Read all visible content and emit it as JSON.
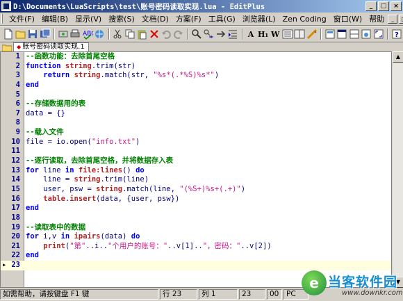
{
  "window": {
    "title": "D:\\Documents\\LuaScripts\\test\\账号密码读取实现.lua - EditPlus",
    "controls": [
      "_",
      "□",
      "×"
    ]
  },
  "menubar": {
    "items": [
      "文件(F)",
      "编辑(B)",
      "显示(V)",
      "搜索(S)",
      "文档(D)",
      "方案(F)",
      "工具(G)",
      "浏览器(L)",
      "Zen Coding",
      "窗口(W)",
      "帮助"
    ],
    "right_controls": [
      "_",
      "□",
      "×"
    ]
  },
  "toolbar": {
    "text_buttons": [
      "A",
      "H₁",
      "W"
    ],
    "icons": [
      "new-file-icon",
      "open-folder-icon",
      "save-icon",
      "save-all-icon",
      "ftp-icon",
      "print-icon",
      "spellcheck-icon",
      "preview-icon",
      "cut-icon",
      "copy-icon",
      "paste-icon",
      "clear-icon",
      "undo-icon",
      "redo-icon",
      "find-icon",
      "replace-icon",
      "goto-icon",
      "indent-icon",
      "font-icon",
      "hex-icon",
      "word-wrap-icon",
      "line-number-icon",
      "column-icon",
      "ruler-icon",
      "edit-icon",
      "window-icon",
      "split-icon",
      "browser-icon",
      "fullscreen-icon",
      "help-icon"
    ]
  },
  "tab": {
    "label": "账号密码读取实现.1"
  },
  "editor": {
    "current_line": 23,
    "lines": [
      {
        "n": "1",
        "parts": [
          [
            "cm",
            "--函数功能：去除首尾空格"
          ]
        ]
      },
      {
        "n": "2",
        "parts": [
          [
            "kw",
            "function"
          ],
          [
            "pl",
            " "
          ],
          [
            "fn",
            "string"
          ],
          [
            "pl",
            ".trim(str)"
          ]
        ]
      },
      {
        "n": "3",
        "parts": [
          [
            "pl",
            "    "
          ],
          [
            "kw",
            "return"
          ],
          [
            "pl",
            " "
          ],
          [
            "fn",
            "string"
          ],
          [
            "pl",
            ".match(str, "
          ],
          [
            "str",
            "\"%s*(.*%S)%s*\""
          ],
          [
            "pl",
            ")"
          ]
        ]
      },
      {
        "n": "4",
        "parts": [
          [
            "kw",
            "end"
          ]
        ]
      },
      {
        "n": "5",
        "parts": []
      },
      {
        "n": "6",
        "parts": [
          [
            "cm",
            "--存储数据用的表"
          ]
        ]
      },
      {
        "n": "7",
        "parts": [
          [
            "pl",
            "data = {}"
          ]
        ]
      },
      {
        "n": "8",
        "parts": []
      },
      {
        "n": "9",
        "parts": [
          [
            "cm",
            "--载入文件"
          ]
        ]
      },
      {
        "n": "10",
        "parts": [
          [
            "pl",
            "file = io.open("
          ],
          [
            "str",
            "\"info.txt\""
          ],
          [
            "pl",
            ")"
          ]
        ]
      },
      {
        "n": "11",
        "parts": []
      },
      {
        "n": "12",
        "parts": [
          [
            "cm",
            "--逐行读取，去除首尾空格，并将数据存入表"
          ]
        ]
      },
      {
        "n": "13",
        "parts": [
          [
            "kw",
            "for"
          ],
          [
            "pl",
            " line "
          ],
          [
            "kw",
            "in"
          ],
          [
            "pl",
            " "
          ],
          [
            "fn",
            "file:lines"
          ],
          [
            "pl",
            "() "
          ],
          [
            "kw",
            "do"
          ]
        ]
      },
      {
        "n": "14",
        "parts": [
          [
            "pl",
            "    line = "
          ],
          [
            "fn",
            "string"
          ],
          [
            "pl",
            ".trim(line)"
          ]
        ]
      },
      {
        "n": "15",
        "parts": [
          [
            "pl",
            "    user, psw = "
          ],
          [
            "fn",
            "string"
          ],
          [
            "pl",
            ".match(line, "
          ],
          [
            "str",
            "\"(%S+)%s+(.+)\""
          ],
          [
            "pl",
            ")"
          ]
        ]
      },
      {
        "n": "16",
        "parts": [
          [
            "pl",
            "    "
          ],
          [
            "fn",
            "table"
          ],
          [
            "pl",
            "."
          ],
          [
            "fn",
            "insert"
          ],
          [
            "pl",
            "(data, {user, psw})"
          ]
        ]
      },
      {
        "n": "17",
        "parts": [
          [
            "kw",
            "end"
          ]
        ]
      },
      {
        "n": "18",
        "parts": []
      },
      {
        "n": "19",
        "parts": [
          [
            "cm",
            "--读取表中的数据"
          ]
        ]
      },
      {
        "n": "20",
        "parts": [
          [
            "kw",
            "for"
          ],
          [
            "pl",
            " i,v "
          ],
          [
            "kw",
            "in"
          ],
          [
            "pl",
            " "
          ],
          [
            "fn",
            "ipairs"
          ],
          [
            "pl",
            "(data) "
          ],
          [
            "kw",
            "do"
          ]
        ]
      },
      {
        "n": "21",
        "parts": [
          [
            "pl",
            "    "
          ],
          [
            "fn",
            "print"
          ],
          [
            "pl",
            "("
          ],
          [
            "str",
            "\"第\""
          ],
          [
            "pl",
            "..i.."
          ],
          [
            "str",
            "\"个用户的账号：\""
          ],
          [
            "pl",
            "..v[1].."
          ],
          [
            "str",
            "\"，密码：\""
          ],
          [
            "pl",
            "..v[2])"
          ]
        ]
      },
      {
        "n": "22",
        "parts": [
          [
            "kw",
            "end"
          ]
        ]
      },
      {
        "n": "23",
        "parts": []
      }
    ]
  },
  "statusbar": {
    "help": "如需帮助，请按键盘 F1 键",
    "line": "行 23",
    "col": "列 1",
    "pos": "23",
    "num": "00",
    "mode": "PC"
  },
  "watermark": {
    "title": "当客软件园",
    "url": "www.downkr.com",
    "logo_letter": "e"
  },
  "colors": {
    "title_start": "#0a246a",
    "keyword": "#0000ff",
    "function": "#b22222",
    "string": "#c71585",
    "comment": "#008000",
    "line_number": "#00008b"
  }
}
